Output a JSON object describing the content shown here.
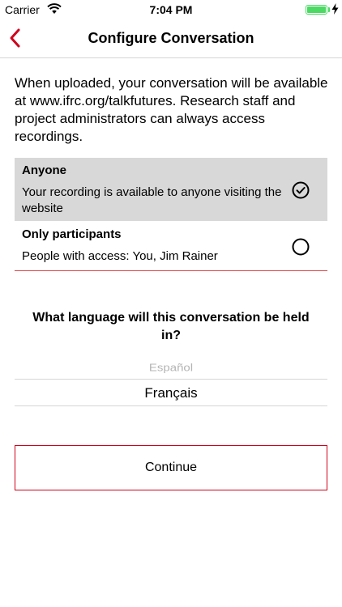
{
  "status_bar": {
    "carrier": "Carrier",
    "time": "7:04 PM",
    "battery_level": 1.0
  },
  "nav": {
    "title": "Configure Conversation",
    "back_icon": "chevron-left-icon"
  },
  "intro": "When uploaded, your conversation will be available at www.ifrc.org/talkfutures. Research staff and project administrators can always access recordings.",
  "options": [
    {
      "title": "Anyone",
      "description": "Your recording is available to anyone visiting the website",
      "selected": true
    },
    {
      "title": "Only participants",
      "description": "People with access: You, Jim Rainer",
      "selected": false
    }
  ],
  "language": {
    "question": "What language will this conversation be held in?",
    "options_visible": [
      "Español",
      "Français"
    ],
    "selected": "Français"
  },
  "continue_label": "Continue",
  "colors": {
    "accent": "#d0021b",
    "selected_bg": "#d8d8d8",
    "battery": "#4cd964"
  }
}
